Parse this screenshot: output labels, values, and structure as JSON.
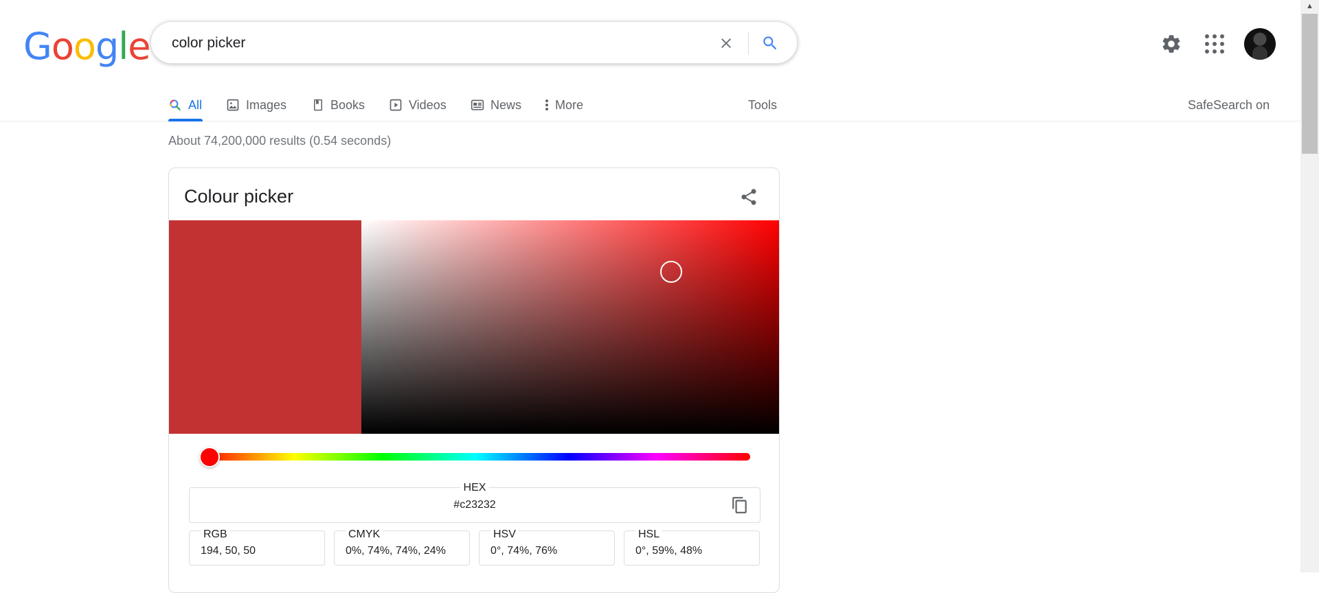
{
  "header": {
    "logo_text": "Google",
    "logo_letters": [
      {
        "ch": "G",
        "color": "#4285f4"
      },
      {
        "ch": "o",
        "color": "#ea4335"
      },
      {
        "ch": "o",
        "color": "#fbbc05"
      },
      {
        "ch": "g",
        "color": "#4285f4"
      },
      {
        "ch": "l",
        "color": "#34a853"
      },
      {
        "ch": "e",
        "color": "#ea4335"
      }
    ],
    "search_query": "color picker"
  },
  "nav": {
    "tabs": [
      {
        "label": "All",
        "icon": "search-icon",
        "active": true
      },
      {
        "label": "Images",
        "icon": "image-icon"
      },
      {
        "label": "Books",
        "icon": "book-icon"
      },
      {
        "label": "Videos",
        "icon": "video-icon"
      },
      {
        "label": "News",
        "icon": "news-icon"
      },
      {
        "label": "More",
        "icon": "more-vert-icon"
      }
    ],
    "tools_label": "Tools",
    "safesearch_label": "SafeSearch on"
  },
  "result_stats": "About 74,200,000 results (0.54 seconds)",
  "colour_picker": {
    "title": "Colour picker",
    "selected_color": "#c23232",
    "hue_color": "#ff0000",
    "hue_degrees": 0,
    "saturation": 0.74,
    "value": 0.76,
    "hex_label": "HEX",
    "hex_value": "#c23232",
    "fields": [
      {
        "label": "RGB",
        "value": "194, 50, 50"
      },
      {
        "label": "CMYK",
        "value": "0%, 74%, 74%, 24%"
      },
      {
        "label": "HSV",
        "value": "0°, 74%, 76%"
      },
      {
        "label": "HSL",
        "value": "0°, 59%, 48%"
      }
    ]
  },
  "colors": {
    "accent": "#1a73e8",
    "text_secondary": "#5f6368"
  }
}
